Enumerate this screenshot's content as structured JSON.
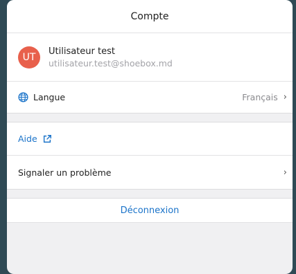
{
  "header": {
    "title": "Compte"
  },
  "user": {
    "initials": "UT",
    "name": "Utilisateur test",
    "email": "utilisateur.test@shoebox.md"
  },
  "language": {
    "label": "Langue",
    "value": "Français",
    "chevron": "›"
  },
  "help": {
    "label": "Aide"
  },
  "report": {
    "label": "Signaler un problème",
    "chevron": "›"
  },
  "logout": {
    "label": "Déconnexion"
  },
  "colors": {
    "accent": "#1a73c9",
    "avatar": "#e8604c",
    "background": "#2f4a55"
  },
  "icons": {
    "language": "globe-icon",
    "help": "external-link-icon"
  }
}
